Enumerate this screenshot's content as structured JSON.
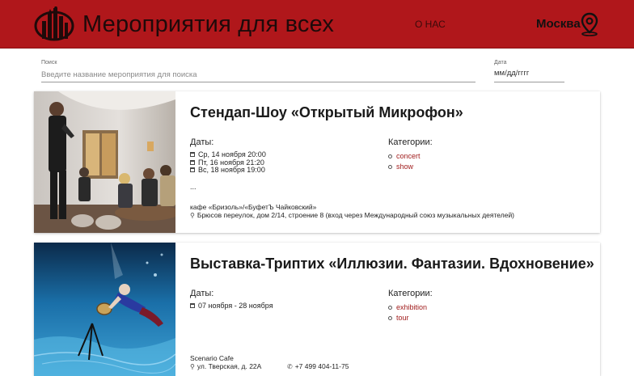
{
  "header": {
    "site_title": "Мероприятия для всех",
    "nav_about": "О НАС",
    "city": "Москва",
    "logo_icon": "city-skyline-logo",
    "location_icon": "map-pin-icon",
    "brand_color": "#b0171b"
  },
  "search": {
    "label": "Поиск",
    "placeholder": "Введите название мероприятия для поиска",
    "value": ""
  },
  "date_filter": {
    "label": "Дата",
    "value": "мм/дд/гггг"
  },
  "events": [
    {
      "title": "Стендап-Шоу «Открытый Микрофон»",
      "dates_label": "Даты:",
      "dates": [
        "Ср, 14 ноября 20:00",
        "Пт, 16 ноября 21:20",
        "Вс, 18 ноября 19:00"
      ],
      "more": "...",
      "categories_label": "Категории:",
      "categories": [
        "concert",
        "show"
      ],
      "venue": "кафе «Бризоль»/«БуфетЪ Чайковский»",
      "address": "Брюсов переулок, дом 2/14, строение 8 (вход через Международный союз музыкальных деятелей)",
      "phone": ""
    },
    {
      "title": "Выставка-Триптих «Иллюзии. Фантазии. Вдохновение»",
      "dates_label": "Даты:",
      "dates": [
        "07 ноября - 28 ноября"
      ],
      "more": "",
      "categories_label": "Категории:",
      "categories": [
        "exhibition",
        "tour"
      ],
      "venue": "Scenario Cafe",
      "address": "ул. Тверская, д. 22А",
      "phone": "+7 499 404-11-75"
    }
  ]
}
